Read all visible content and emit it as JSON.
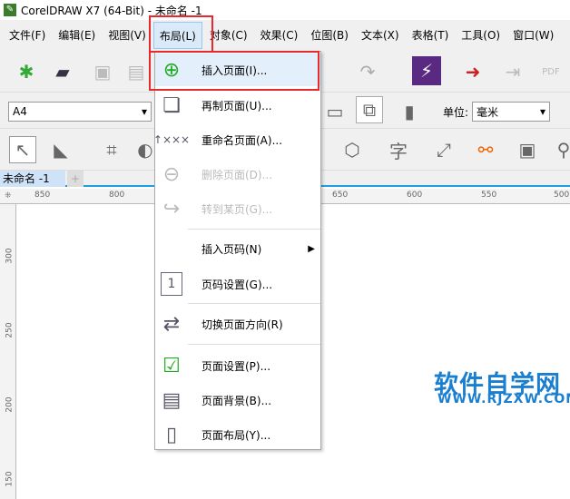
{
  "title": "CorelDRAW X7 (64-Bit) - 未命名 -1",
  "menubar": [
    "文件(F)",
    "编辑(E)",
    "视图(V)",
    "布局(L)",
    "对象(C)",
    "效果(C)",
    "位图(B)",
    "文本(X)",
    "表格(T)",
    "工具(O)",
    "窗口(W)"
  ],
  "toolbar": {
    "page_size": "A4",
    "unit_label": "单位:",
    "unit_value": "毫米"
  },
  "document_tab": "未命名 -1",
  "ruler_h": [
    "850",
    "800",
    "650",
    "600",
    "550",
    "500"
  ],
  "ruler_v": [
    "300",
    "250",
    "200",
    "150"
  ],
  "layout_menu": [
    {
      "label": "插入页面(I)...",
      "icon": "insert-page-icon",
      "enabled": true,
      "highlighted": true
    },
    {
      "label": "再制页面(U)...",
      "icon": "duplicate-page-icon",
      "enabled": true
    },
    {
      "label": "重命名页面(A)...",
      "icon": "rename-page-icon",
      "enabled": true
    },
    {
      "label": "删除页面(D)...",
      "icon": "delete-page-icon",
      "enabled": false
    },
    {
      "label": "转到某页(G)...",
      "icon": "goto-page-icon",
      "enabled": false
    },
    {
      "label": "插入页码(N)",
      "icon": "",
      "enabled": true,
      "submenu": true
    },
    {
      "label": "页码设置(G)...",
      "icon": "page-number-settings-icon",
      "enabled": true
    },
    {
      "label": "切换页面方向(R)",
      "icon": "switch-orientation-icon",
      "enabled": true
    },
    {
      "label": "页面设置(P)...",
      "icon": "page-setup-icon",
      "enabled": true
    },
    {
      "label": "页面背景(B)...",
      "icon": "page-background-icon",
      "enabled": true
    },
    {
      "label": "页面布局(Y)...",
      "icon": "page-layout-icon",
      "enabled": true
    }
  ],
  "watermark": {
    "title": "软件自学网",
    "url": "WWW.RJZXW.COM"
  }
}
